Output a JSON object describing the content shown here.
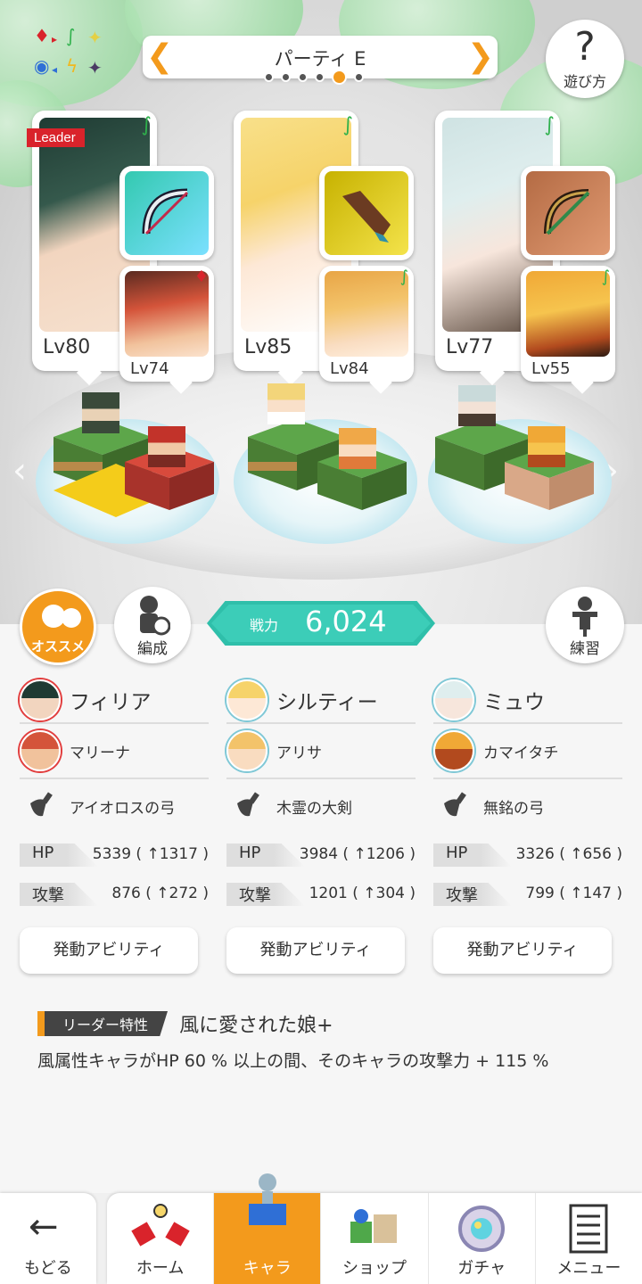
{
  "party": {
    "title": "パーティ E",
    "page_count": 6,
    "active_page": 5
  },
  "howto": {
    "label": "遊び方",
    "symbol": "?"
  },
  "leader_badge": "Leader",
  "cards": [
    {
      "main_level": "Lv80",
      "sub_level": "Lv74"
    },
    {
      "main_level": "Lv85",
      "sub_level": "Lv84"
    },
    {
      "main_level": "Lv77",
      "sub_level": "Lv55"
    }
  ],
  "osusume": {
    "label": "オススメ"
  },
  "hensei": {
    "label": "編成"
  },
  "renshu": {
    "label": "練習"
  },
  "power": {
    "label": "戦力",
    "value": "6,024"
  },
  "members": [
    {
      "main_name": "フィリア",
      "sub_name": "マリーナ",
      "weapon": "アイオロスの弓",
      "hp_label": "HP",
      "hp_value": "5339 ( ↑1317 )",
      "atk_label": "攻撃",
      "atk_value": "876 ( ↑272 )",
      "ability": "発動アビリティ"
    },
    {
      "main_name": "シルティー",
      "sub_name": "アリサ",
      "weapon": "木霊の大剣",
      "hp_label": "HP",
      "hp_value": "3984 ( ↑1206 )",
      "atk_label": "攻撃",
      "atk_value": "1201 ( ↑304 )",
      "ability": "発動アビリティ"
    },
    {
      "main_name": "ミュウ",
      "sub_name": "カマイタチ",
      "weapon": "無銘の弓",
      "hp_label": "HP",
      "hp_value": "3326 ( ↑656 )",
      "atk_label": "攻撃",
      "atk_value": "799 ( ↑147 )",
      "ability": "発動アビリティ"
    }
  ],
  "leader_skill": {
    "tag": "リーダー特性",
    "name": "風に愛された娘+",
    "description": "風属性キャラがHP 60 % 以上の間、そのキャラの攻撃力 + 115 %"
  },
  "nav": {
    "back": "もどる",
    "tabs": [
      {
        "label": "ホーム",
        "icon": "home-icon"
      },
      {
        "label": "キャラ",
        "icon": "chara-icon",
        "active": true
      },
      {
        "label": "ショップ",
        "icon": "shop-icon"
      },
      {
        "label": "ガチャ",
        "icon": "gacha-icon"
      },
      {
        "label": "メニュー",
        "icon": "menu-icon"
      }
    ]
  },
  "colors": {
    "accent": "#f39a1c",
    "power": "#3ccdb8",
    "wind": "#2fb14c",
    "fire": "#d9232b"
  }
}
